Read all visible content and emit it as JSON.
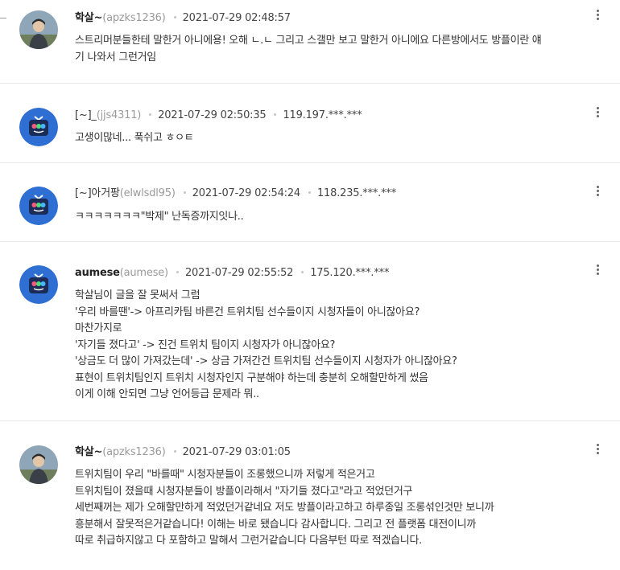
{
  "comments": [
    {
      "nickname": "학살~",
      "user_id": "(apzks1236)",
      "datetime": "2021-07-29 02:48:57",
      "ip": "",
      "lines": [
        "스트리머분들한테 말한거 아니에용! 오해 ㄴ.ㄴ 그리고 스갤만 보고 말한거 아니에요 다른방에서도 방플이란 얘",
        "기 나와서 그런거임"
      ]
    },
    {
      "nickname": "[~]_",
      "user_id": "(jjs4311)",
      "datetime": "2021-07-29 02:50:35",
      "ip": "119.197.***.***",
      "lines": [
        "고생이많네... 푹쉬고 ㅎㅇㅌ"
      ]
    },
    {
      "nickname": "[~]아거팡",
      "user_id": "(elwlsdl95)",
      "datetime": "2021-07-29 02:54:24",
      "ip": "118.235.***.***",
      "lines": [
        "ㅋㅋㅋㅋㅋㅋㅋ\"박제\" 난독증까지잇나.."
      ]
    },
    {
      "nickname": "aumese",
      "user_id": "(aumese)",
      "datetime": "2021-07-29 02:55:52",
      "ip": "175.120.***.***",
      "lines": [
        "학살님이 글을 잘 못써서 그럼",
        "'우리 바를땐'-> 아프리카팀 바른건 트위치팀 선수들이지 시청자들이 아니잖아요?",
        "마찬가지로",
        "'자기들 졌다고' -> 진건 트위치 팀이지 시청자가 아니잖아요?",
        "'상금도 더 많이 가져갔는데' -> 상금 가져간건 트위치팀 선수들이지 시청자가 아니잖아요?",
        "표현이 트위치팀인지 트위치 시청자인지 구분해야 하는데 충분히 오해할만하게 썼음",
        "이게 이해 안되면 그냥 언어등급 문제라 뭐.."
      ]
    },
    {
      "nickname": "학살~",
      "user_id": "(apzks1236)",
      "datetime": "2021-07-29 03:01:05",
      "ip": "",
      "lines": [
        "트위치팀이 우리 \"바를때\" 시청자분들이 조롱했으니까 저렇게 적은거고",
        "트위치팀이 졌을때 시청자분들이 방플이라해서 \"자기들 졌다고\"라고 적었던거구",
        "세번째꺼는 제가 오해할만하게 적었던거같네요 저도 방플이라고하고 하루종일 조롱섞인것만 보니까",
        "흥분해서 잘못적은거같습니다! 이해는 바로 됐습니다 감사합니다. 그리고 전 플랫폼 대전이니까",
        "따로 취급하지않고 다 포함하고 말해서 그런거같습니다 다음부턴 따로 적겠습니다."
      ]
    }
  ]
}
